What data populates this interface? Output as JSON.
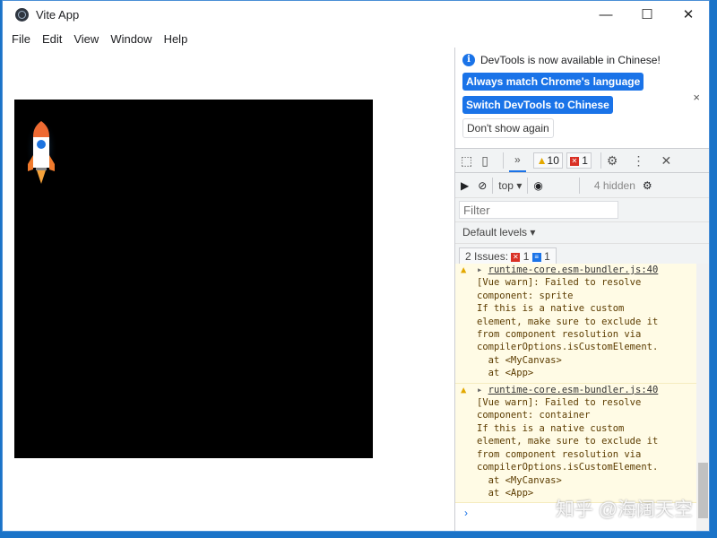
{
  "window": {
    "title": "Vite App",
    "minimize": "—",
    "maximize": "☐",
    "close": "✕"
  },
  "menu": [
    "File",
    "Edit",
    "View",
    "Window",
    "Help"
  ],
  "devtools": {
    "infobar": {
      "message": "DevTools is now available in Chinese!",
      "btn_match": "Always match Chrome's language",
      "btn_switch": "Switch DevTools to Chinese",
      "btn_dont": "Don't show again",
      "close": "×"
    },
    "toolbar": {
      "more_tabs": "»",
      "warnings": "10",
      "errors": "1"
    },
    "console_toolbar": {
      "context": "top",
      "hidden": "4 hidden"
    },
    "filter_placeholder": "Filter",
    "levels": "Default levels",
    "issues": {
      "label": "2 Issues:",
      "errors": "1",
      "info": "1"
    },
    "entries": [
      {
        "source": "runtime-core.esm-bundler.js:40",
        "text": "[Vue warn]: Failed to resolve\ncomponent: sprite\nIf this is a native custom\nelement, make sure to exclude it\nfrom component resolution via\ncompilerOptions.isCustomElement.\n  at <MyCanvas>\n  at <App>"
      },
      {
        "source": "runtime-core.esm-bundler.js:40",
        "text": "[Vue warn]: Failed to resolve\ncomponent: container\nIf this is a native custom\nelement, make sure to exclude it\nfrom component resolution via\ncompilerOptions.isCustomElement.\n  at <MyCanvas>\n  at <App>"
      }
    ],
    "prompt": "›"
  },
  "watermark": "知乎 @海阔天空"
}
